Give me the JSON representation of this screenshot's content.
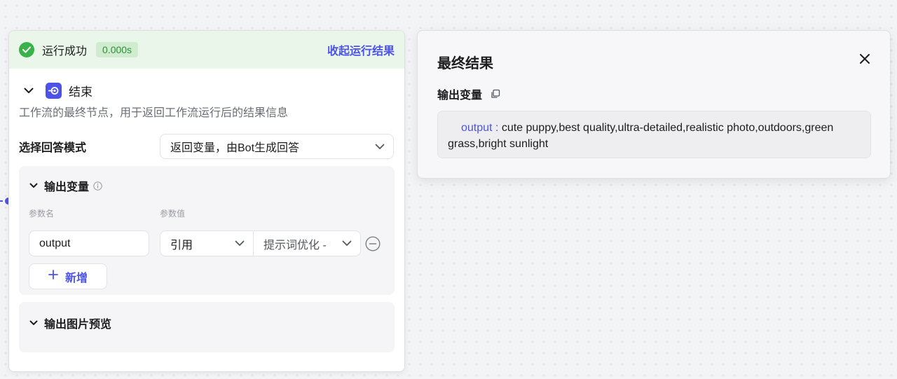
{
  "node": {
    "status_text": "运行成功",
    "duration": "0.000s",
    "collapse_link": "收起运行结果",
    "title": "结束",
    "description": "工作流的最终节点，用于返回工作流运行后的结果信息",
    "mode_label": "选择回答模式",
    "mode_value": "返回变量，由Bot生成回答",
    "output_section": {
      "title": "输出变量",
      "col_name": "参数名",
      "col_value": "参数值",
      "var_name": "output",
      "ref_type": "引用",
      "ref_value": "提示词优化 -",
      "add_label": "新增"
    },
    "preview_section": {
      "title": "输出图片预览"
    }
  },
  "result": {
    "title": "最终结果",
    "output_label": "输出变量",
    "output_key": "output :",
    "output_value": " cute puppy,best quality,ultra-detailed,realistic photo,outdoors,green grass,bright sunlight"
  },
  "colors": {
    "accent": "#4d53e8",
    "success": "#38b34a",
    "success_bg": "#e9f6e9"
  }
}
